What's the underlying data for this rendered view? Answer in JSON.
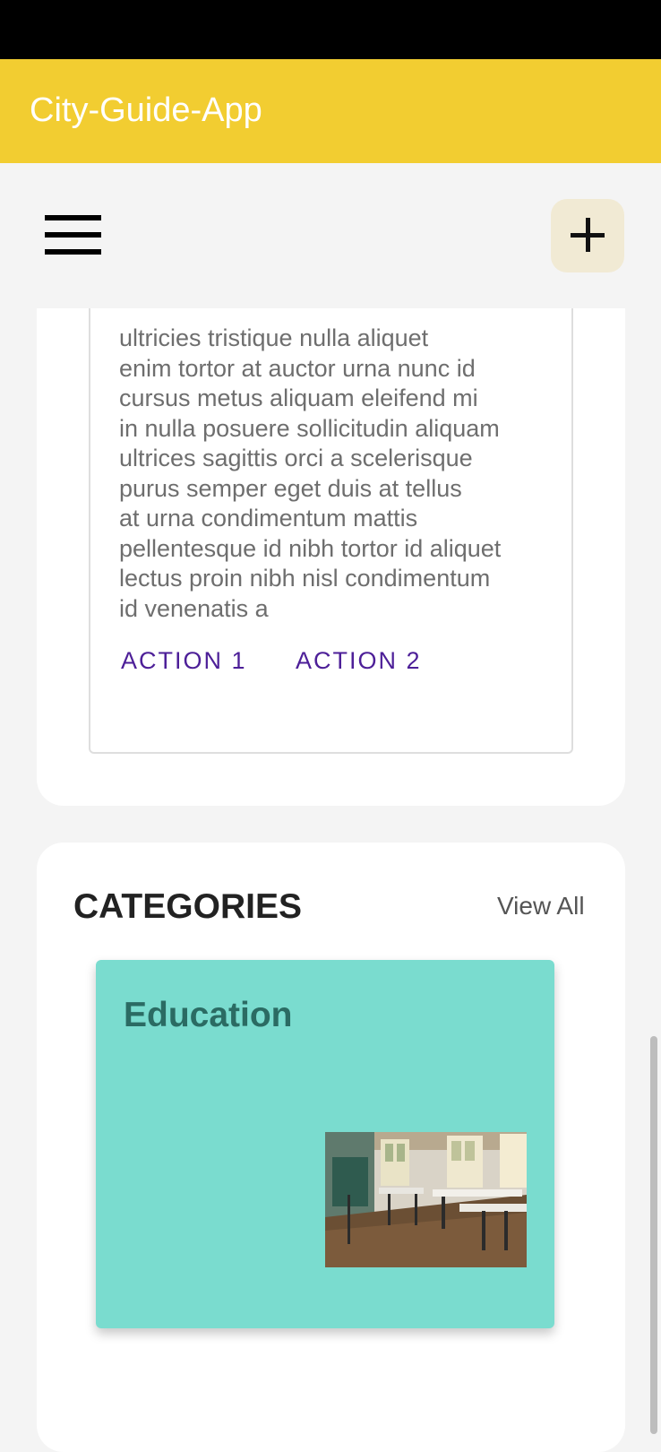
{
  "app": {
    "title": "City-Guide-App"
  },
  "toolbar": {
    "menu_icon": "hamburger-menu-icon",
    "add_icon": "plus-icon"
  },
  "info_card": {
    "lines": [
      "ultricies tristique nulla aliquet",
      "enim tortor at auctor urna nunc id",
      "cursus metus aliquam eleifend mi",
      "in nulla posuere sollicitudin aliquam",
      "ultrices sagittis orci a scelerisque",
      "purus semper eget duis at tellus",
      "at urna condimentum mattis",
      "pellentesque id nibh tortor id aliquet",
      "lectus proin nibh nisl condimentum",
      "id venenatis a"
    ],
    "action1": "ACTION 1",
    "action2": "ACTION 2"
  },
  "categories": {
    "title": "CATEGORIES",
    "view_all": "View All",
    "items": [
      {
        "label": "Education",
        "color": "#7adccf",
        "image": "classroom-photo"
      }
    ]
  },
  "colors": {
    "app_bar": "#f2cd31",
    "action_text": "#4d1f98",
    "card_bg": "#7adccf"
  }
}
